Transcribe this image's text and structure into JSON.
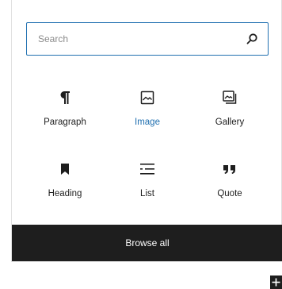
{
  "search": {
    "placeholder": "Search",
    "value": ""
  },
  "blocks": [
    {
      "label": "Paragraph",
      "icon": "paragraph-icon",
      "active": false
    },
    {
      "label": "Image",
      "icon": "image-icon",
      "active": true
    },
    {
      "label": "Gallery",
      "icon": "gallery-icon",
      "active": false
    },
    {
      "label": "Heading",
      "icon": "bookmark-icon",
      "active": false
    },
    {
      "label": "List",
      "icon": "list-icon",
      "active": false
    },
    {
      "label": "Quote",
      "icon": "quote-icon",
      "active": false
    }
  ],
  "browse_all": {
    "label": "Browse all"
  },
  "colors": {
    "accent": "#2271b1",
    "dark": "#1e1e1e"
  }
}
